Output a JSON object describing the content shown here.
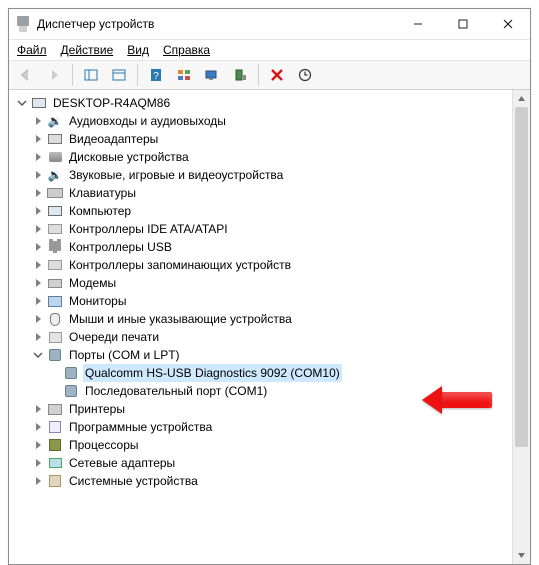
{
  "window": {
    "title": "Диспетчер устройств"
  },
  "menu": {
    "file": "Файл",
    "action": "Действие",
    "view": "Вид",
    "help": "Справка"
  },
  "tree": {
    "root": "DESKTOP-R4AQM86",
    "items": [
      {
        "label": "Аудиовходы и аудиовыходы"
      },
      {
        "label": "Видеоадаптеры"
      },
      {
        "label": "Дисковые устройства"
      },
      {
        "label": "Звуковые, игровые и видеоустройства"
      },
      {
        "label": "Клавиатуры"
      },
      {
        "label": "Компьютер"
      },
      {
        "label": "Контроллеры IDE ATA/ATAPI"
      },
      {
        "label": "Контроллеры USB"
      },
      {
        "label": "Контроллеры запоминающих устройств"
      },
      {
        "label": "Модемы"
      },
      {
        "label": "Мониторы"
      },
      {
        "label": "Мыши и иные указывающие устройства"
      },
      {
        "label": "Очереди печати"
      },
      {
        "label": "Порты (COM и LPT)"
      },
      {
        "label": "Принтеры"
      },
      {
        "label": "Программные устройства"
      },
      {
        "label": "Процессоры"
      },
      {
        "label": "Сетевые адаптеры"
      },
      {
        "label": "Системные устройства"
      }
    ],
    "ports_children": [
      {
        "label": "Qualcomm HS-USB Diagnostics 9092 (COM10)"
      },
      {
        "label": "Последовательный порт (COM1)"
      }
    ],
    "selected_path": "ports_children.0.label"
  }
}
